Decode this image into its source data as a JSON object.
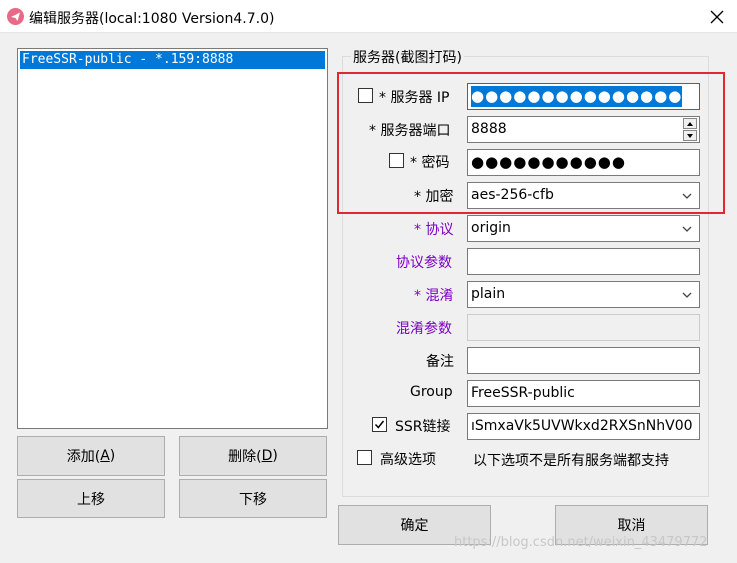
{
  "window": {
    "title": "编辑服务器(local:1080 Version4.7.0)",
    "app_icon": "paper-plane-icon",
    "close_icon": "close-icon"
  },
  "server_list": {
    "items": [
      "FreeSSR-public - *.159:8888"
    ],
    "selected_index": 0
  },
  "list_buttons": {
    "add_label": "添加(",
    "add_key": "A",
    "delete_label": "删除(",
    "delete_key": "D",
    "close_paren": ")",
    "move_up_label": "上移",
    "move_down_label": "下移"
  },
  "server_group": {
    "title": "服务器(截图打码)",
    "fields": {
      "server_ip": {
        "required_mark": "* ",
        "label": "服务器 IP",
        "value": "●●●●●●●●●●●●●●●",
        "checked": false
      },
      "server_port": {
        "required_mark": "* ",
        "label": "服务器端口",
        "value": "8888"
      },
      "password": {
        "required_mark": "* ",
        "label": "密码",
        "value": "●●●●●●●●●●●",
        "checked": false
      },
      "encryption": {
        "required_mark": "* ",
        "label": "加密",
        "value": "aes-256-cfb"
      },
      "protocol": {
        "required_mark": "* ",
        "label": "协议",
        "value": "origin"
      },
      "protocol_param": {
        "label": "协议参数",
        "value": ""
      },
      "obfs": {
        "required_mark": "* ",
        "label": "混淆",
        "value": "plain"
      },
      "obfs_param": {
        "label": "混淆参数",
        "value": ""
      },
      "remarks": {
        "label": "备注",
        "value": ""
      },
      "group": {
        "label": "Group",
        "value": "FreeSSR-public"
      },
      "ssr_link": {
        "label": "SSR链接",
        "value": "ıSmxaVk5UVWkxd2RXSnNhV00",
        "checked": true
      }
    },
    "advanced": {
      "label": "高级选项",
      "checked": false,
      "note": "以下选项不是所有服务端都支持"
    }
  },
  "dialog_buttons": {
    "ok_label": "确定",
    "cancel_label": "取消"
  },
  "watermark": "https://blog.csdn.net/weixin_43479772",
  "colors": {
    "selection": "#0078d7",
    "purple_label": "#7a00c8",
    "highlight_box": "#e0282e"
  }
}
